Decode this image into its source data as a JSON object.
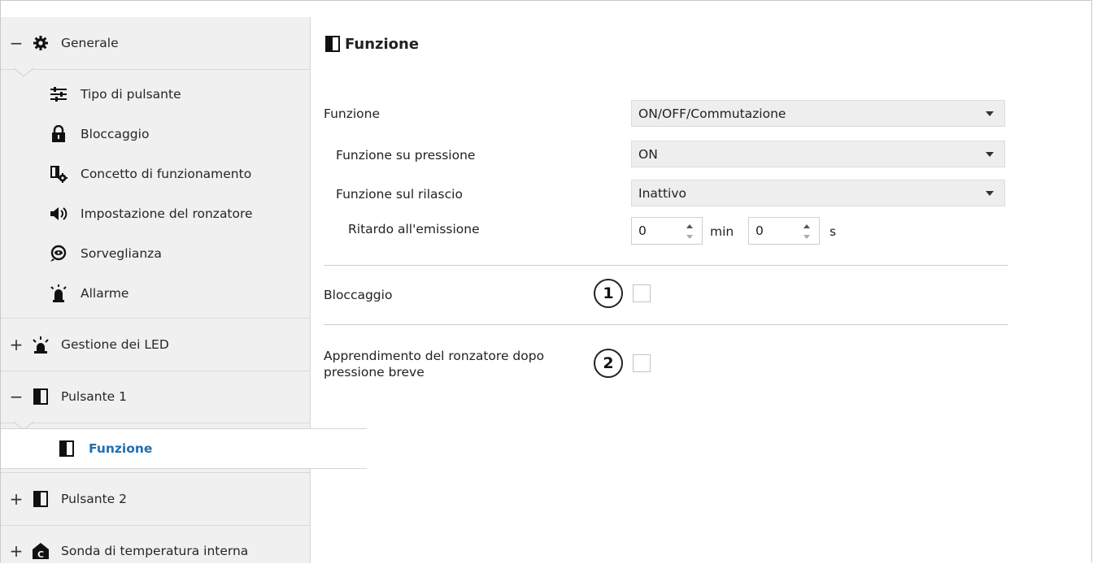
{
  "sidebar": {
    "generale": {
      "sign": "−",
      "label": "Generale"
    },
    "items": [
      {
        "label": "Tipo di pulsante",
        "icon": "sliders-icon"
      },
      {
        "label": "Bloccaggio",
        "icon": "lock-icon"
      },
      {
        "label": "Concetto di funzionamento",
        "icon": "device-gear-icon"
      },
      {
        "label": "Impostazione del ronzatore",
        "icon": "speaker-icon"
      },
      {
        "label": "Sorveglianza",
        "icon": "eye-icon"
      },
      {
        "label": "Allarme",
        "icon": "alarm-icon"
      }
    ],
    "led": {
      "sign": "+",
      "label": "Gestione dei LED"
    },
    "pulsante1": {
      "sign": "−",
      "label": "Pulsante 1"
    },
    "funzione": {
      "label": "Funzione"
    },
    "pulsante2": {
      "sign": "+",
      "label": "Pulsante 2"
    },
    "sonda": {
      "sign": "+",
      "label": "Sonda di temperatura interna"
    }
  },
  "main": {
    "title": "Funzione",
    "fields": {
      "funzione": {
        "label": "Funzione",
        "value": "ON/OFF/Commutazione"
      },
      "pressione": {
        "label": "Funzione su pressione",
        "value": "ON"
      },
      "rilascio": {
        "label": "Funzione sul rilascio",
        "value": "Inattivo"
      },
      "ritardo": {
        "label": "Ritardo all'emissione",
        "min_value": "0",
        "min_unit": "min",
        "sec_value": "0",
        "sec_unit": "s"
      }
    },
    "bloccaggio": {
      "label": "Bloccaggio",
      "badge": "1",
      "checked": false
    },
    "apprendimento": {
      "label_line1": "Apprendimento del ronzatore dopo",
      "label_line2": "pressione breve",
      "badge": "2",
      "checked": false
    }
  },
  "colors": {
    "selected_text": "#1e6fb0",
    "sidebar_bg": "#f0f0f0"
  }
}
